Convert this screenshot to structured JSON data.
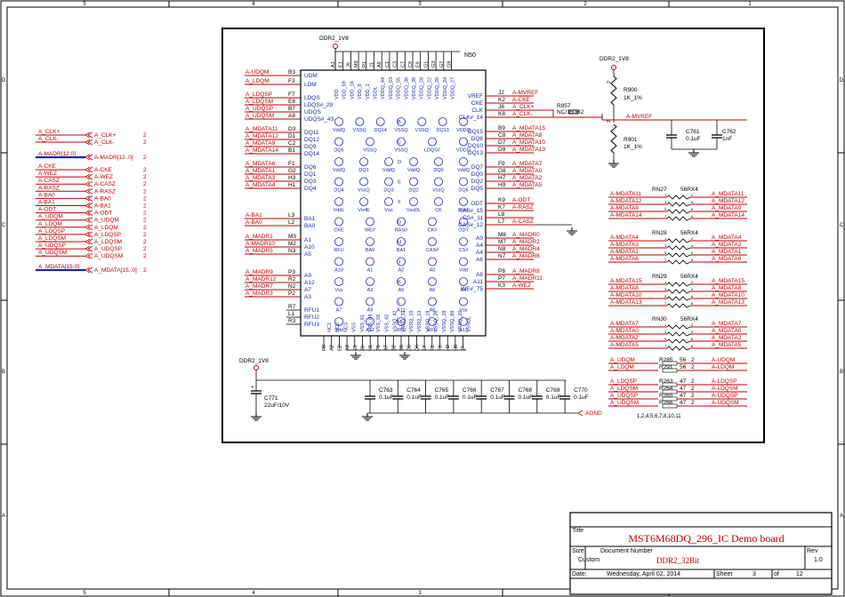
{
  "frame": {
    "columns": [
      "5",
      "4",
      "3",
      "2",
      "1"
    ],
    "rows": [
      "D",
      "C",
      "B",
      "A"
    ]
  },
  "left_ports": {
    "single": [
      {
        "net": "A_CLK+",
        "port": "A_CLK+",
        "page": "2"
      },
      {
        "net": "A_CLK-",
        "port": "A_CLK-",
        "page": "2"
      }
    ],
    "madr_bus": {
      "net": "A-MADR[12:0]",
      "port": "A-MADR[12..0]",
      "page": "2"
    },
    "group": [
      {
        "net": "A-CKE",
        "port": "A-CKE",
        "page": "2"
      },
      {
        "net": "A-WEZ",
        "port": "A-WEZ",
        "page": "2"
      },
      {
        "net": "A-CASZ",
        "port": "A-CASZ",
        "page": "2"
      },
      {
        "net": "A-RASZ",
        "port": "A-RASZ",
        "page": "2"
      },
      {
        "net": "A-BA0",
        "port": "A-BA0",
        "page": "2"
      },
      {
        "net": "A-BA1",
        "port": "A-BA1",
        "page": "2"
      },
      {
        "net": "A-ODT",
        "port": "A-ODT",
        "page": "2"
      },
      {
        "net": "A_UDQM",
        "port": "A_UDQM",
        "page": "2"
      },
      {
        "net": "A_LDQM",
        "port": "A_LDQM",
        "page": "2"
      },
      {
        "net": "A_LDQSP",
        "port": "A_LDQSP",
        "page": "2"
      },
      {
        "net": "A_LDQSM",
        "port": "A_LDQSM",
        "page": "2"
      },
      {
        "net": "A_UDQSP",
        "port": "A_UDQSP",
        "page": "2"
      },
      {
        "net": "A_UDQSM",
        "port": "A_UDQSM",
        "page": "2"
      }
    ],
    "mdata_bus": {
      "net": "A_MDATA[15:0]",
      "port": "A_MDATA[15..0]",
      "page": "2"
    }
  },
  "ic": {
    "power_label": "DDR2_1V8",
    "refdes": "N50",
    "top_pins": [
      "A1",
      "E1",
      "J9",
      "M9",
      "R1",
      "J1",
      "A9",
      "C1",
      "C3",
      "C7",
      "C9",
      "E9",
      "G1",
      "G3",
      "G7",
      "G9"
    ],
    "top_names": [
      "VDD",
      "VDD_59",
      "VDD_16",
      "VDD_8",
      "VDD_1",
      "VDDL",
      "VDDQ_44",
      "VDDQ_53",
      "VDDQ_55",
      "VDDQ_36",
      "VDDQ_38",
      "VDDQ_28",
      "VDDQ_22",
      "VDDQ_20",
      "VDDQ_24",
      "VDDQ_27"
    ],
    "bottom_pins": [
      "R8",
      "A2",
      "E2",
      "A3",
      "E3",
      "J3",
      "N1",
      "P9",
      "A7",
      "B2",
      "B8",
      "D2",
      "D8",
      "E7",
      "F2",
      "F8",
      "H2",
      "H8",
      "J7"
    ],
    "bottom_names": [
      "NC1",
      "NC2",
      "NC3",
      "VSS",
      "VSS_61",
      "VSS_64",
      "VSS_58",
      "VSS_42",
      "VSSQ_42",
      "VSSQ_31",
      "VSSQ_15",
      "VSSQ_13",
      "VSSQ_19",
      "VSSQ_26",
      "VSSQ_29",
      "VSSQ_68",
      "VSSQ_20",
      "VSSDL"
    ],
    "left_pins": [
      {
        "num": "B3",
        "name": "UDM",
        "net": "A-UDQM"
      },
      {
        "num": "F3",
        "name": "LDM",
        "net": "A_LDQM"
      },
      {
        "num": "F7",
        "name": "LDQS",
        "net": "A_LDQSP"
      },
      {
        "num": "E8",
        "name": "LDQS#_29",
        "net": "A_LDQSM"
      },
      {
        "num": "B7",
        "name": "UDQS",
        "net": "A_UDQSP"
      },
      {
        "num": "A8",
        "name": "UDQS#_43",
        "net": "A_UDQSM"
      },
      {
        "num": "D3",
        "name": "DQ11",
        "net": "A_MDATA11"
      },
      {
        "num": "D1",
        "name": "DQ12",
        "net": "A_MDATA12"
      },
      {
        "num": "C2",
        "name": "DQ9",
        "net": "A_MDATA9"
      },
      {
        "num": "B1",
        "name": "DQ14",
        "net": "A_MDATA14"
      },
      {
        "num": "F1",
        "name": "DQ6",
        "net": "A_MDATA6"
      },
      {
        "num": "G2",
        "name": "DQ1",
        "net": "A_MDATA1"
      },
      {
        "num": "H3",
        "name": "DQ3",
        "net": "A_MDATA3"
      },
      {
        "num": "H1",
        "name": "DQ4",
        "net": "A_MDATA4"
      },
      {
        "num": "L3",
        "name": "BA1",
        "net": "A-BA1"
      },
      {
        "num": "L2",
        "name": "BA0",
        "net": "A-BA0"
      },
      {
        "num": "M3",
        "name": "A1",
        "net": "A_MADR1"
      },
      {
        "num": "M2",
        "name": "A10",
        "net": "A-MADR10"
      },
      {
        "num": "N3",
        "name": "A5",
        "net": "A_MADR5"
      },
      {
        "num": "P3",
        "name": "A9",
        "net": "A_MADR9"
      },
      {
        "num": "R2",
        "name": "A12",
        "net": "A_MADR12"
      },
      {
        "num": "N2",
        "name": "A7",
        "net": "A_MADR7"
      },
      {
        "num": "P2",
        "name": "A3",
        "net": "A_MADR3"
      },
      {
        "num": "R7",
        "name": "RFU1",
        "net": ""
      },
      {
        "num": "L1",
        "name": "RFU2",
        "net": ""
      },
      {
        "num": "R3",
        "name": "RFU3",
        "net": ""
      }
    ],
    "right_pins": [
      {
        "num": "J2",
        "name": "VREF",
        "net": "A-MVREF"
      },
      {
        "num": "K2",
        "name": "CKE",
        "net": "A-CKE"
      },
      {
        "num": "J8",
        "name": "CLK",
        "net": "A_CLK+"
      },
      {
        "num": "K8",
        "name": "CLK#_14",
        "net": "A_CLK-"
      },
      {
        "num": "B9",
        "name": "DQ15",
        "net": "A_MDATA15"
      },
      {
        "num": "C8",
        "name": "DQ8",
        "net": "A_MDATA8"
      },
      {
        "num": "D7",
        "name": "DQ10",
        "net": "A_MDATA10"
      },
      {
        "num": "D9",
        "name": "DQ13",
        "net": "A_MDATA13"
      },
      {
        "num": "F9",
        "name": "DQ7",
        "net": "A_MDATA7"
      },
      {
        "num": "G8",
        "name": "DQ0",
        "net": "A_MDATA0"
      },
      {
        "num": "H7",
        "name": "DQ2",
        "net": "A_MDATA2"
      },
      {
        "num": "H9",
        "name": "DQ5",
        "net": "A_MDATA5"
      },
      {
        "num": "K9",
        "name": "ODT",
        "net": "A-ODT"
      },
      {
        "num": "K7",
        "name": "RAS#_15",
        "net": "A-RASZ"
      },
      {
        "num": "L8",
        "name": "CS#_11",
        "net": ""
      },
      {
        "num": "L7",
        "name": "CAS#_12",
        "net": "A-CASZ"
      },
      {
        "num": "M8",
        "name": "A0",
        "net": "A_MADR0"
      },
      {
        "num": "M7",
        "name": "A4",
        "net": "A_MADR2"
      },
      {
        "num": "N8",
        "name": "A4",
        "net": "A_MADR4"
      },
      {
        "num": "N7",
        "name": "A6",
        "net": "A_MADR6"
      },
      {
        "num": "P8",
        "name": "A8",
        "net": "A_MADR8"
      },
      {
        "num": "P7",
        "name": "A11",
        "net": "A_MADR11"
      },
      {
        "num": "K3",
        "name": "WE#_75",
        "net": "A-WEZ"
      }
    ],
    "ball_rows": [
      [
        "VddQ",
        "VSSQ",
        "DQ14",
        "VSSQ",
        "VSSQ",
        "DQ13",
        "VDDQ"
      ],
      [
        "DQ6",
        "VSSQ",
        "VSSQ",
        "LDQS#",
        "VDDQ"
      ],
      [
        "VddQ",
        "DQ1",
        "VddQ",
        "VddQ",
        "DQ0",
        "VddQ"
      ],
      [
        "DQ4",
        "VssQ",
        "DQ3",
        "DQ2",
        "VssQ",
        "DQ5"
      ],
      [
        "VddL",
        "VrefE",
        "Vss",
        "VssDL",
        "CK",
        "Vdd"
      ],
      [
        "CKE",
        "WE#",
        "RAS#",
        "CK#",
        "ODT"
      ],
      [
        "RFU",
        "BA0",
        "BA1",
        "CAS#",
        "CS#"
      ],
      [
        "A10",
        "A1",
        "A2",
        "A0",
        "Vdd"
      ],
      [
        "Vss",
        "A3",
        "A5",
        "A6",
        "A4"
      ],
      [
        "A7",
        "A9",
        "A11",
        "A8",
        "Vss"
      ],
      [
        "Vdd",
        "A12",
        "RFU",
        "RFU",
        "A13"
      ]
    ],
    "ball_letters": [
      "A",
      "B",
      "C",
      "D",
      "E",
      "F",
      "G",
      "H",
      "J",
      "K",
      "L",
      "M",
      "N",
      "P",
      "R"
    ]
  },
  "clk_term": {
    "refdes": "R857",
    "value": "NC/150R2",
    "net_pos": "A_CLK+",
    "net_neg": "A_CLK-"
  },
  "vref_divider": {
    "power": "DDR2_1V8",
    "r1": {
      "refdes": "R900",
      "value": "1K_1%"
    },
    "r2": {
      "refdes": "R901",
      "value": "1K_1%"
    },
    "net": "A-MVREF",
    "c1": {
      "refdes": "C761",
      "value": "0.1uF"
    },
    "c2": {
      "refdes": "C762",
      "value": "1nF"
    },
    "pin_labels": [
      "2",
      "1",
      "2",
      "1"
    ]
  },
  "rpacks": [
    {
      "refdes": "RN27",
      "value": "56RX4",
      "left": [
        "A-MDATA11",
        "A-MDATA12",
        "A-MDATA9",
        "A-MDATA14"
      ],
      "right": [
        "A_MDATA11",
        "A_MDATA12",
        "A_MDATA9",
        "A_MDATA14"
      ],
      "pins": [
        "8",
        "7",
        "6",
        "5",
        "4",
        "3",
        "2",
        "1"
      ]
    },
    {
      "refdes": "RN28",
      "value": "56RX4",
      "left": [
        "A-MDATA4",
        "A-MDATA3",
        "A-MDATA1",
        "A-MDATA6"
      ],
      "right": [
        "A_MDATA4",
        "A_MDATA3",
        "A_MDATA1",
        "A_MDATA6"
      ],
      "pins": [
        "8",
        "7",
        "6",
        "5",
        "4",
        "3",
        "2",
        "1"
      ]
    },
    {
      "refdes": "RN29",
      "value": "56RX4",
      "left": [
        "A-MDATA15",
        "A-MDATA8",
        "A-MDATA10",
        "A-MDATA13"
      ],
      "right": [
        "A_MDATA15",
        "A_MDATA8",
        "A_MDATA10",
        "A_MDATA13"
      ],
      "pins": [
        "8",
        "7",
        "6",
        "5",
        "4",
        "3",
        "2",
        "1"
      ]
    },
    {
      "refdes": "RN30",
      "value": "56RX4",
      "left": [
        "A-MDATA7",
        "A-MDATA0",
        "A-MDATA2",
        "A-MDATA5"
      ],
      "right": [
        "A_MDATA7",
        "A_MDATA0",
        "A_MDATA2",
        "A_MDATA5"
      ],
      "pins": [
        "8",
        "7",
        "6",
        "5",
        "4",
        "3",
        "2",
        "1"
      ]
    }
  ],
  "series_res": [
    {
      "left": "A_UDQM",
      "ref": "R285",
      "value": "56",
      "pin": "2",
      "right": "A-UDQM"
    },
    {
      "left": "A_LDQM",
      "ref": "R291",
      "value": "56",
      "pin": "2",
      "right": "A-LDQM"
    },
    {
      "left": "A_LDQSP",
      "ref": "R263",
      "value": "47",
      "pin": "2",
      "right": "A-LDQSP"
    },
    {
      "left": "A_LDQSM",
      "ref": "R264",
      "value": "47",
      "pin": "2",
      "right": "A-LDQSM"
    },
    {
      "left": "A_UDQSP",
      "ref": "R265",
      "value": "47",
      "pin": "2",
      "right": "A-UDQSP"
    },
    {
      "left": "A_UDQSM",
      "ref": "R266",
      "value": "47",
      "pin": "2",
      "right": "A-UDQSM"
    }
  ],
  "rpack_note": "1,2,4,5,6,7,8,10,11",
  "decoupling": {
    "power": "DDR2_1V8",
    "bulk": {
      "refdes": "C771",
      "value": "22uF/10V"
    },
    "caps": [
      {
        "refdes": "C763",
        "value": "0.1uF"
      },
      {
        "refdes": "C764",
        "value": "0.1uF"
      },
      {
        "refdes": "C765",
        "value": "0.1uF"
      },
      {
        "refdes": "C766",
        "value": "0.1uF"
      },
      {
        "refdes": "C767",
        "value": "0.1uF"
      },
      {
        "refdes": "C768",
        "value": "0.1uF"
      },
      {
        "refdes": "C769",
        "value": "0.1uF"
      },
      {
        "refdes": "C770",
        "value": "0.1uF"
      }
    ],
    "agnd": "AGND"
  },
  "title_block": {
    "title_label": "Title",
    "title": "MST6M68DQ_296_IC Demo board",
    "size_label": "Size",
    "size": "Custom",
    "docnum_label": "Document Number",
    "docnum": "DDR2_32Bit",
    "rev_label": "Rev",
    "rev": "1.0",
    "date_label": "Date:",
    "date": "Wednesday, April 02, 2014",
    "sheet_label": "Sheet",
    "sheet": "3",
    "of_label": "of",
    "total": "12"
  }
}
